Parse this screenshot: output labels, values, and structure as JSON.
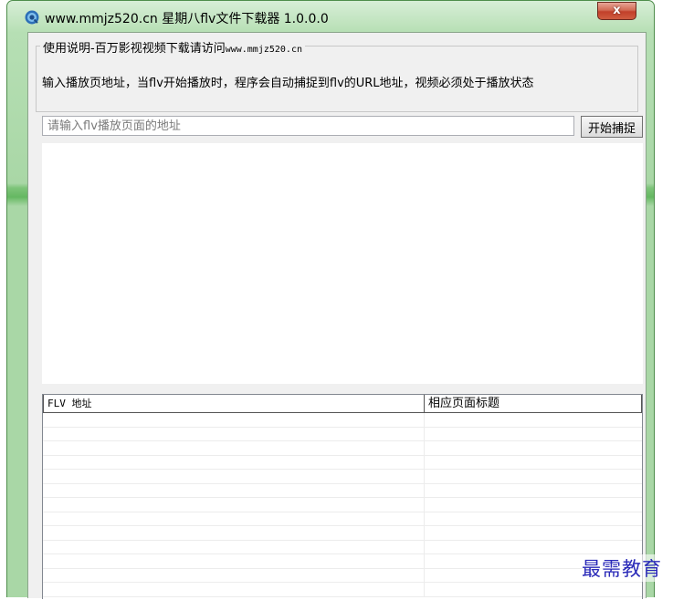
{
  "window": {
    "title": "www.mmjz520.cn 星期八flv文件下载器 1.0.0.0",
    "close_label": "x"
  },
  "instructions": {
    "legend_prefix": "使用说明-百万影视视频下载请访问",
    "legend_site": "www.mmjz520.cn",
    "description": "输入播放页地址，当flv开始播放时，程序会自动捕捉到flv的URL地址，视频必须处于播放状态"
  },
  "url_input": {
    "placeholder": "请输入flv播放页面的地址",
    "value": ""
  },
  "start_button": {
    "label": "开始捕捉"
  },
  "list": {
    "columns": [
      {
        "label": "FLV 地址"
      },
      {
        "label": "相应页面标题"
      }
    ]
  },
  "watermark": {
    "text": "最需教育"
  },
  "colors": {
    "frame_green": "#a9d7a6",
    "close_red": "#c2402a",
    "watermark_blue": "#2a2ab8"
  }
}
